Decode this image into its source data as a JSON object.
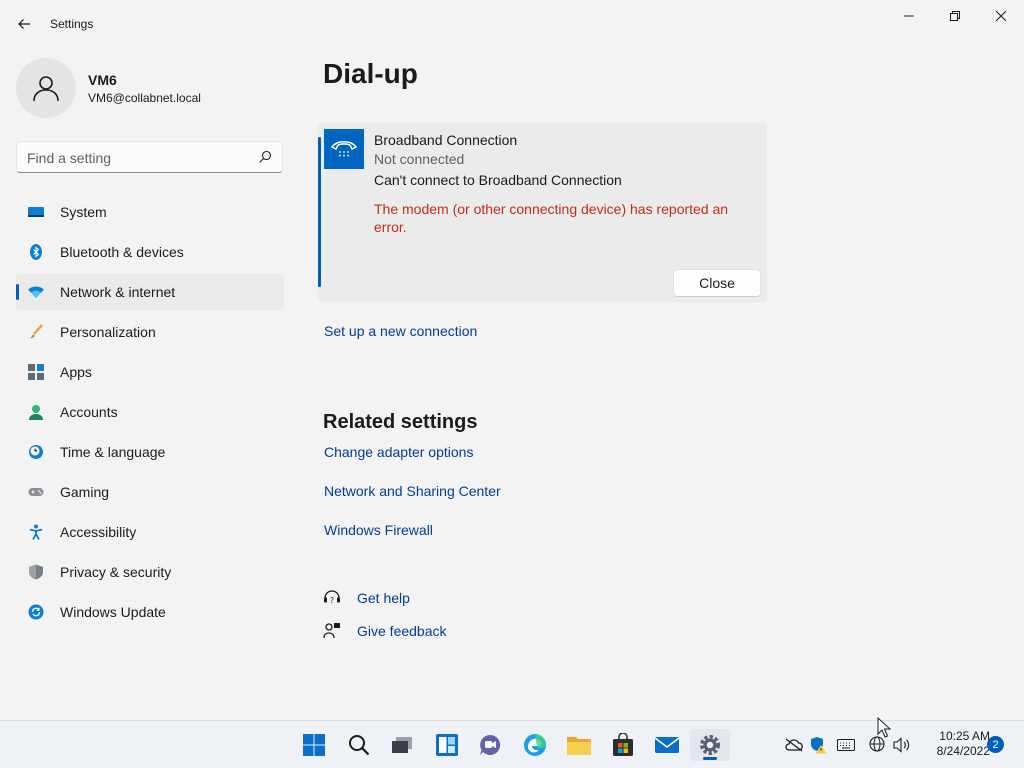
{
  "window": {
    "title": "Settings"
  },
  "user": {
    "name": "VM6",
    "email": "VM6@collabnet.local"
  },
  "search": {
    "placeholder": "Find a setting"
  },
  "sidebar": {
    "items": [
      {
        "label": "System",
        "icon": "system-icon",
        "active": false
      },
      {
        "label": "Bluetooth & devices",
        "icon": "bluetooth-icon",
        "active": false
      },
      {
        "label": "Network & internet",
        "icon": "network-icon",
        "active": true
      },
      {
        "label": "Personalization",
        "icon": "brush-icon",
        "active": false
      },
      {
        "label": "Apps",
        "icon": "apps-icon",
        "active": false
      },
      {
        "label": "Accounts",
        "icon": "accounts-icon",
        "active": false
      },
      {
        "label": "Time & language",
        "icon": "clock-globe-icon",
        "active": false
      },
      {
        "label": "Gaming",
        "icon": "gamepad-icon",
        "active": false
      },
      {
        "label": "Accessibility",
        "icon": "accessibility-icon",
        "active": false
      },
      {
        "label": "Privacy & security",
        "icon": "shield-icon",
        "active": false
      },
      {
        "label": "Windows Update",
        "icon": "update-icon",
        "active": false
      }
    ]
  },
  "main": {
    "title": "Dial-up",
    "connection": {
      "name": "Broadband Connection",
      "status": "Not connected",
      "error_title": "Can't connect to Broadband Connection",
      "error_message": "The modem (or other connecting device) has reported an error.",
      "close_label": "Close"
    },
    "setup_link": "Set up a new connection",
    "related": {
      "title": "Related settings",
      "links": [
        "Change adapter options",
        "Network and Sharing Center",
        "Windows Firewall"
      ]
    },
    "help": {
      "get_help": "Get help",
      "give_feedback": "Give feedback"
    }
  },
  "taskbar": {
    "clock_time": "10:25 AM",
    "clock_date": "8/24/2022",
    "notification_count": "2"
  },
  "colors": {
    "accent": "#005fb8",
    "error": "#c42b1c",
    "link": "#003e92"
  }
}
